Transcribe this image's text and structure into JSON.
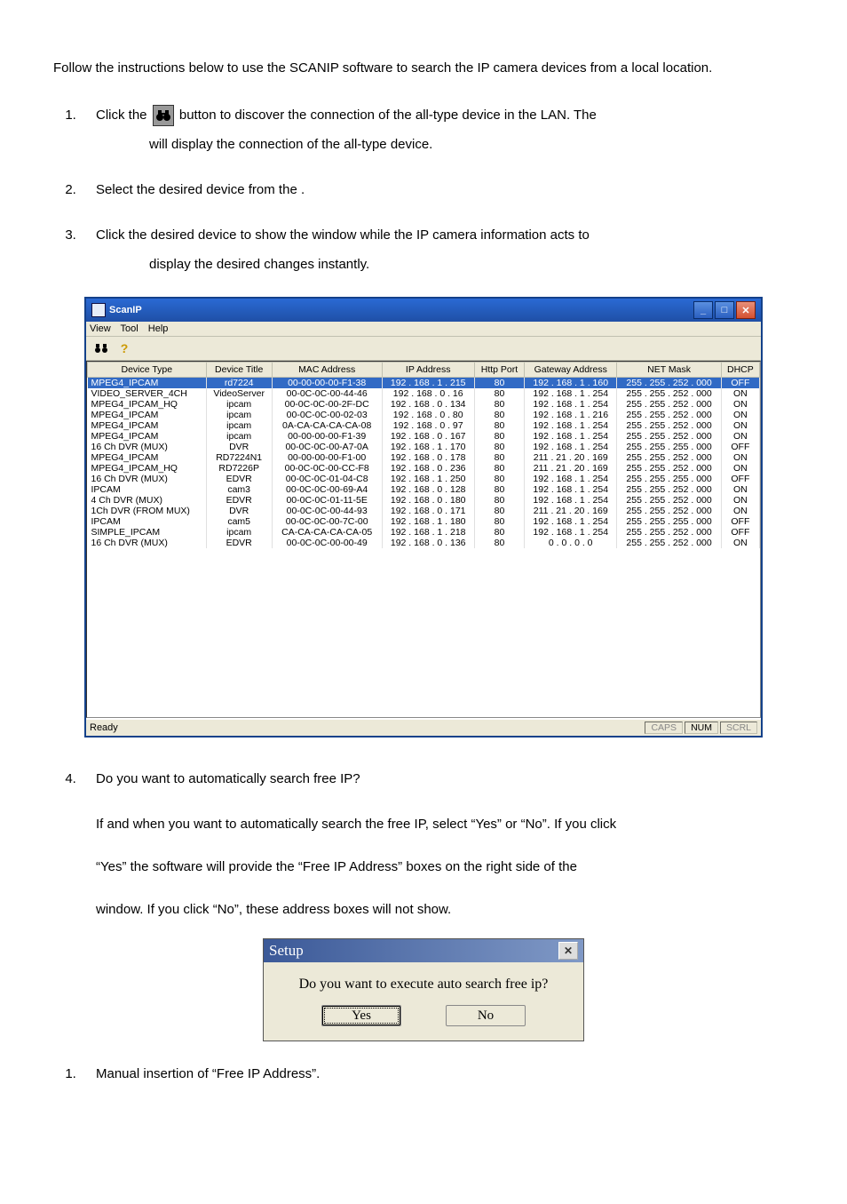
{
  "intro": "Follow the instructions below to use the SCANIP software to search the IP camera devices from a local location.",
  "steps": {
    "s1a": "Click the ",
    "s1b": " button to discover the connection of the all-type device in the LAN. The",
    "s1c": "will display the connection of the all-type device.",
    "s2": "Select the desired device from the                               .",
    "s3": "Click the desired device to show the window while the IP camera information acts to",
    "s3b": "display the desired changes instantly."
  },
  "scanip": {
    "title": "ScanIP",
    "menu": {
      "view": "View",
      "tool": "Tool",
      "help": "Help"
    },
    "headers": {
      "type": "Device Type",
      "title": "Device Title",
      "mac": "MAC Address",
      "ip": "IP Address",
      "port": "Http Port",
      "gateway": "Gateway Address",
      "net": "NET Mask",
      "dhcp": "DHCP"
    },
    "rows": [
      {
        "type": "MPEG4_IPCAM",
        "title": "rd7224",
        "mac": "00-00-00-00-F1-38",
        "ip": "192 . 168 . 1 . 215",
        "port": "80",
        "gw": "192 . 168 . 1 . 160",
        "mask": "255 . 255 . 252 . 000",
        "dhcp": "OFF",
        "sel": true
      },
      {
        "type": "VIDEO_SERVER_4CH",
        "title": "VideoServer",
        "mac": "00-0C-0C-00-44-46",
        "ip": "192 . 168 . 0 . 16",
        "port": "80",
        "gw": "192 . 168 . 1 . 254",
        "mask": "255 . 255 . 252 . 000",
        "dhcp": "ON"
      },
      {
        "type": "MPEG4_IPCAM_HQ",
        "title": "ipcam",
        "mac": "00-0C-0C-00-2F-DC",
        "ip": "192 . 168 . 0 . 134",
        "port": "80",
        "gw": "192 . 168 . 1 . 254",
        "mask": "255 . 255 . 252 . 000",
        "dhcp": "ON"
      },
      {
        "type": "MPEG4_IPCAM",
        "title": "ipcam",
        "mac": "00-0C-0C-00-02-03",
        "ip": "192 . 168 . 0 . 80",
        "port": "80",
        "gw": "192 . 168 . 1 . 216",
        "mask": "255 . 255 . 252 . 000",
        "dhcp": "ON"
      },
      {
        "type": "MPEG4_IPCAM",
        "title": "ipcam",
        "mac": "0A-CA-CA-CA-CA-08",
        "ip": "192 . 168 . 0 . 97",
        "port": "80",
        "gw": "192 . 168 . 1 . 254",
        "mask": "255 . 255 . 252 . 000",
        "dhcp": "ON"
      },
      {
        "type": "MPEG4_IPCAM",
        "title": "ipcam",
        "mac": "00-00-00-00-F1-39",
        "ip": "192 . 168 . 0 . 167",
        "port": "80",
        "gw": "192 . 168 . 1 . 254",
        "mask": "255 . 255 . 252 . 000",
        "dhcp": "ON"
      },
      {
        "type": "16 Ch DVR (MUX)",
        "title": "DVR",
        "mac": "00-0C-0C-00-A7-0A",
        "ip": "192 . 168 . 1 . 170",
        "port": "80",
        "gw": "192 . 168 . 1 . 254",
        "mask": "255 . 255 . 255 . 000",
        "dhcp": "OFF"
      },
      {
        "type": "MPEG4_IPCAM",
        "title": "RD7224N1",
        "mac": "00-00-00-00-F1-00",
        "ip": "192 . 168 . 0 . 178",
        "port": "80",
        "gw": "211 . 21 . 20 . 169",
        "mask": "255 . 255 . 252 . 000",
        "dhcp": "ON"
      },
      {
        "type": "MPEG4_IPCAM_HQ",
        "title": "RD7226P",
        "mac": "00-0C-0C-00-CC-F8",
        "ip": "192 . 168 . 0 . 236",
        "port": "80",
        "gw": "211 . 21 . 20 . 169",
        "mask": "255 . 255 . 252 . 000",
        "dhcp": "ON"
      },
      {
        "type": "16 Ch DVR (MUX)",
        "title": "EDVR",
        "mac": "00-0C-0C-01-04-C8",
        "ip": "192 . 168 . 1 . 250",
        "port": "80",
        "gw": "192 . 168 . 1 . 254",
        "mask": "255 . 255 . 255 . 000",
        "dhcp": "OFF"
      },
      {
        "type": "IPCAM",
        "title": "cam3",
        "mac": "00-0C-0C-00-69-A4",
        "ip": "192 . 168 . 0 . 128",
        "port": "80",
        "gw": "192 . 168 . 1 . 254",
        "mask": "255 . 255 . 252 . 000",
        "dhcp": "ON"
      },
      {
        "type": "4 Ch DVR (MUX)",
        "title": "EDVR",
        "mac": "00-0C-0C-01-11-5E",
        "ip": "192 . 168 . 0 . 180",
        "port": "80",
        "gw": "192 . 168 . 1 . 254",
        "mask": "255 . 255 . 252 . 000",
        "dhcp": "ON"
      },
      {
        "type": "1Ch DVR (FROM MUX)",
        "title": "DVR",
        "mac": "00-0C-0C-00-44-93",
        "ip": "192 . 168 . 0 . 171",
        "port": "80",
        "gw": "211 . 21 . 20 . 169",
        "mask": "255 . 255 . 252 . 000",
        "dhcp": "ON"
      },
      {
        "type": "IPCAM",
        "title": "cam5",
        "mac": "00-0C-0C-00-7C-00",
        "ip": "192 . 168 . 1 . 180",
        "port": "80",
        "gw": "192 . 168 . 1 . 254",
        "mask": "255 . 255 . 255 . 000",
        "dhcp": "OFF"
      },
      {
        "type": "SIMPLE_IPCAM",
        "title": "ipcam",
        "mac": "CA-CA-CA-CA-CA-05",
        "ip": "192 . 168 . 1 . 218",
        "port": "80",
        "gw": "192 . 168 . 1 . 254",
        "mask": "255 . 255 . 252 . 000",
        "dhcp": "OFF"
      },
      {
        "type": "16 Ch DVR (MUX)",
        "title": "EDVR",
        "mac": "00-0C-0C-00-00-49",
        "ip": "192 . 168 . 0 . 136",
        "port": "80",
        "gw": "0 . 0 . 0 . 0",
        "mask": "255 . 255 . 252 . 000",
        "dhcp": "ON"
      }
    ],
    "status": {
      "ready": "Ready",
      "caps": "CAPS",
      "num": "NUM",
      "scrl": "SCRL"
    }
  },
  "q4": {
    "heading": "Do you want to automatically search free IP?",
    "p1": "If and when you want to automatically search the free IP, select “Yes” or “No”. If you click",
    "p2": "“Yes” the software will provide the “Free IP Address” boxes on the right side of the",
    "p3": "window. If you click “No”, these address boxes will not show."
  },
  "dialog": {
    "title": "Setup",
    "body": "Do you want to execute auto search free ip?",
    "yes": "Yes",
    "no": "No"
  },
  "last": "Manual insertion of “Free IP Address”."
}
